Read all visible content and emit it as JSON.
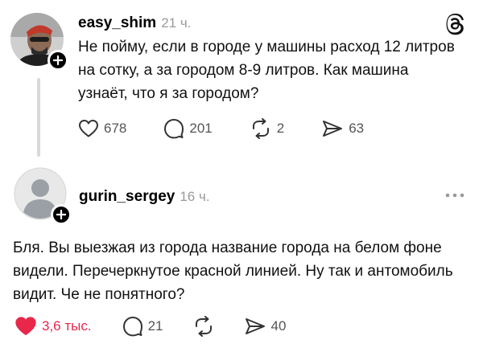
{
  "posts": [
    {
      "username": "easy_shim",
      "time": "21 ч.",
      "text": "Не пойму, если в городе у машины расход 12 литров на сотку, а за городом 8-9 литров. Как машина узнаёт, что я за городом?",
      "likes": "678",
      "replies": "201",
      "reposts": "2",
      "shares": "63",
      "liked": false
    },
    {
      "username": "gurin_sergey",
      "time": "16 ч.",
      "text": "Бля. Вы выезжая из города название города на белом фоне видели. Перечеркнутое красной линией. Ну так и антомобиль видит. Че не понятного?",
      "likes": "3,6 тыс.",
      "replies": "21",
      "reposts": "",
      "shares": "40",
      "liked": true
    }
  ],
  "colors": {
    "like_active": "#e8274b",
    "muted": "#9a9a9a",
    "icon": "#333333"
  },
  "icons": [
    "threads-logo-icon",
    "more-icon",
    "heart-icon",
    "comment-icon",
    "repost-icon",
    "share-icon",
    "plus-icon"
  ]
}
